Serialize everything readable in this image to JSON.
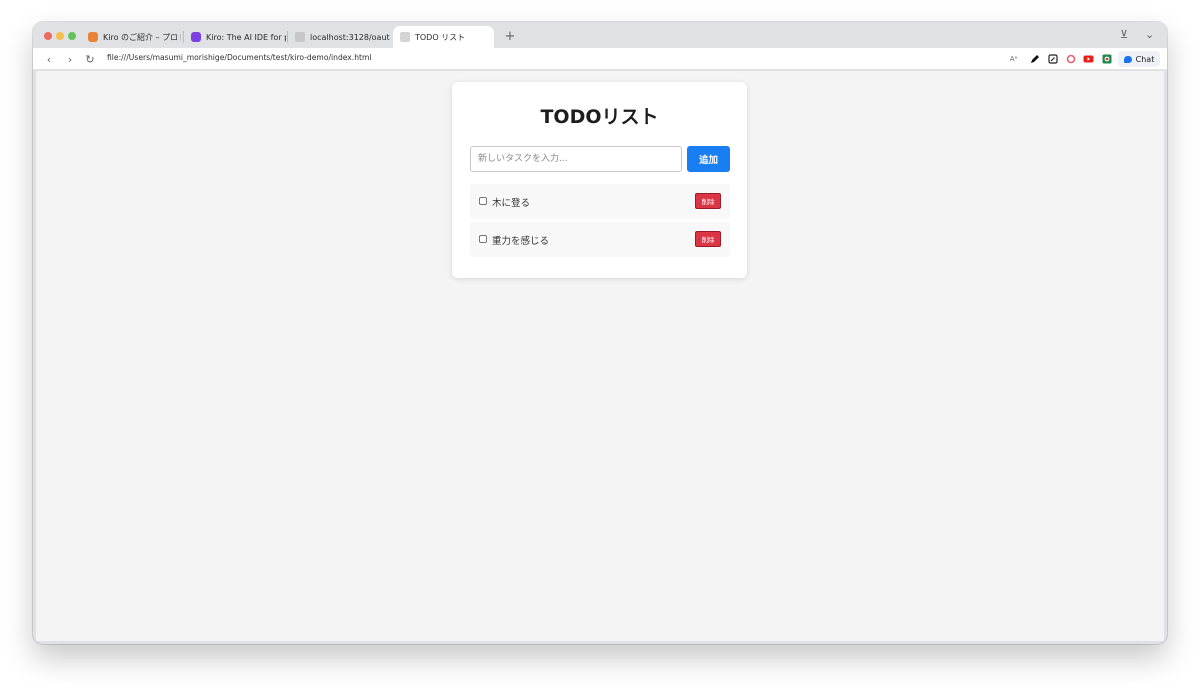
{
  "tabs": [
    {
      "label": "Kiro のご紹介 – プロトタ",
      "favicon": "kiro-ghost-icon",
      "color": "#e8833a"
    },
    {
      "label": "Kiro: The AI IDE for pro",
      "favicon": "kiro-icon",
      "color": "#7b3fe4"
    },
    {
      "label": "localhost:3128/oauth/c",
      "favicon": "page-icon",
      "color": "#c7c7c7"
    },
    {
      "label": "TODO リスト",
      "favicon": "page-icon",
      "color": "#d4d4d4"
    }
  ],
  "tabstrip": {
    "new_tab": "+",
    "download_icon": "⊻",
    "tab_list_icon": "⌄"
  },
  "toolbar": {
    "back": "‹",
    "forward": "›",
    "reload": "↻",
    "url": "file:///Users/masumi_morishige/Documents/test/kiro-demo/index.html",
    "read_aloud": "Aᵃ",
    "chat_label": "Chat"
  },
  "todo": {
    "title": "TODOリスト",
    "input_placeholder": "新しいタスクを入力...",
    "add_label": "追加",
    "items": [
      {
        "text": "木に登る",
        "done": false,
        "delete_label": "削除"
      },
      {
        "text": "重力を感じる",
        "done": false,
        "delete_label": "削除"
      }
    ]
  },
  "colors": {
    "accent": "#1a7ef3",
    "danger": "#dc3545",
    "page_bg": "#f4f4f4"
  }
}
